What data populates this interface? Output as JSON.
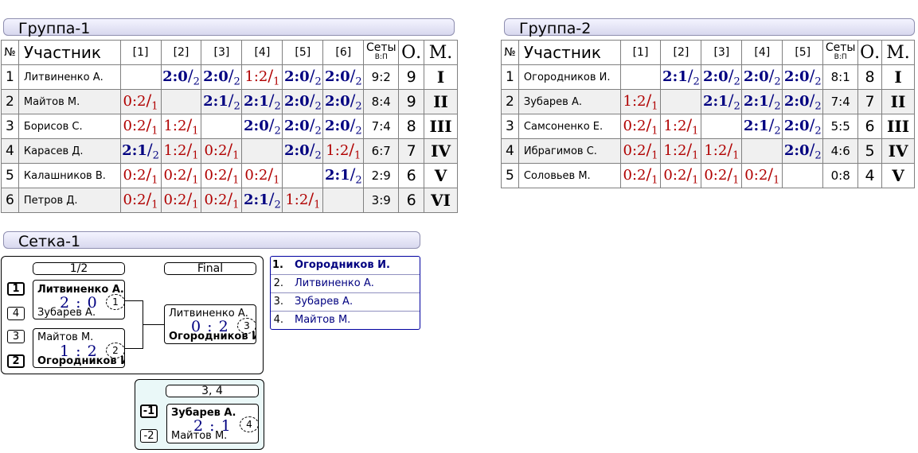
{
  "group1": {
    "title": "Группа-1",
    "headers": {
      "num": "№",
      "participant": "Участник",
      "cols": [
        "[1]",
        "[2]",
        "[3]",
        "[4]",
        "[5]",
        "[6]"
      ],
      "sets": "Сеты",
      "sets_sub": "В:П",
      "points": "О.",
      "place": "М."
    },
    "rows": [
      {
        "num": "1",
        "name": "Литвиненко А.",
        "results": [
          null,
          {
            "s": "2:0",
            "n": "2",
            "w": true
          },
          {
            "s": "2:0",
            "n": "2",
            "w": true
          },
          {
            "s": "1:2",
            "n": "1",
            "w": false
          },
          {
            "s": "2:0",
            "n": "2",
            "w": true
          },
          {
            "s": "2:0",
            "n": "2",
            "w": true
          }
        ],
        "sets": "9:2",
        "points": "9",
        "place": "I"
      },
      {
        "num": "2",
        "name": "Майтов М.",
        "results": [
          {
            "s": "0:2",
            "n": "1",
            "w": false
          },
          null,
          {
            "s": "2:1",
            "n": "2",
            "w": true
          },
          {
            "s": "2:1",
            "n": "2",
            "w": true
          },
          {
            "s": "2:0",
            "n": "2",
            "w": true
          },
          {
            "s": "2:0",
            "n": "2",
            "w": true
          }
        ],
        "sets": "8:4",
        "points": "9",
        "place": "II"
      },
      {
        "num": "3",
        "name": "Борисов С.",
        "results": [
          {
            "s": "0:2",
            "n": "1",
            "w": false
          },
          {
            "s": "1:2",
            "n": "1",
            "w": false
          },
          null,
          {
            "s": "2:0",
            "n": "2",
            "w": true
          },
          {
            "s": "2:0",
            "n": "2",
            "w": true
          },
          {
            "s": "2:0",
            "n": "2",
            "w": true
          }
        ],
        "sets": "7:4",
        "points": "8",
        "place": "III"
      },
      {
        "num": "4",
        "name": "Карасев Д.",
        "results": [
          {
            "s": "2:1",
            "n": "2",
            "w": true
          },
          {
            "s": "1:2",
            "n": "1",
            "w": false
          },
          {
            "s": "0:2",
            "n": "1",
            "w": false
          },
          null,
          {
            "s": "2:0",
            "n": "2",
            "w": true
          },
          {
            "s": "1:2",
            "n": "1",
            "w": false
          }
        ],
        "sets": "6:7",
        "points": "7",
        "place": "IV"
      },
      {
        "num": "5",
        "name": "Калашников В.",
        "results": [
          {
            "s": "0:2",
            "n": "1",
            "w": false
          },
          {
            "s": "0:2",
            "n": "1",
            "w": false
          },
          {
            "s": "0:2",
            "n": "1",
            "w": false
          },
          {
            "s": "0:2",
            "n": "1",
            "w": false
          },
          null,
          {
            "s": "2:1",
            "n": "2",
            "w": true
          }
        ],
        "sets": "2:9",
        "points": "6",
        "place": "V"
      },
      {
        "num": "6",
        "name": "Петров Д.",
        "results": [
          {
            "s": "0:2",
            "n": "1",
            "w": false
          },
          {
            "s": "0:2",
            "n": "1",
            "w": false
          },
          {
            "s": "0:2",
            "n": "1",
            "w": false
          },
          {
            "s": "2:1",
            "n": "2",
            "w": true
          },
          {
            "s": "1:2",
            "n": "1",
            "w": false
          },
          null
        ],
        "sets": "3:9",
        "points": "6",
        "place": "VI"
      }
    ]
  },
  "group2": {
    "title": "Группа-2",
    "headers": {
      "num": "№",
      "participant": "Участник",
      "cols": [
        "[1]",
        "[2]",
        "[3]",
        "[4]",
        "[5]"
      ],
      "sets": "Сеты",
      "sets_sub": "В:П",
      "points": "О.",
      "place": "М."
    },
    "rows": [
      {
        "num": "1",
        "name": "Огородников И.",
        "results": [
          null,
          {
            "s": "2:1",
            "n": "2",
            "w": true
          },
          {
            "s": "2:0",
            "n": "2",
            "w": true
          },
          {
            "s": "2:0",
            "n": "2",
            "w": true
          },
          {
            "s": "2:0",
            "n": "2",
            "w": true
          }
        ],
        "sets": "8:1",
        "points": "8",
        "place": "I"
      },
      {
        "num": "2",
        "name": "Зубарев А.",
        "results": [
          {
            "s": "1:2",
            "n": "1",
            "w": false
          },
          null,
          {
            "s": "2:1",
            "n": "2",
            "w": true
          },
          {
            "s": "2:1",
            "n": "2",
            "w": true
          },
          {
            "s": "2:0",
            "n": "2",
            "w": true
          }
        ],
        "sets": "7:4",
        "points": "7",
        "place": "II"
      },
      {
        "num": "3",
        "name": "Самсоненко Е.",
        "results": [
          {
            "s": "0:2",
            "n": "1",
            "w": false
          },
          {
            "s": "1:2",
            "n": "1",
            "w": false
          },
          null,
          {
            "s": "2:1",
            "n": "2",
            "w": true
          },
          {
            "s": "2:0",
            "n": "2",
            "w": true
          }
        ],
        "sets": "5:5",
        "points": "6",
        "place": "III"
      },
      {
        "num": "4",
        "name": "Ибрагимов С.",
        "results": [
          {
            "s": "0:2",
            "n": "1",
            "w": false
          },
          {
            "s": "1:2",
            "n": "1",
            "w": false
          },
          {
            "s": "1:2",
            "n": "1",
            "w": false
          },
          null,
          {
            "s": "2:0",
            "n": "2",
            "w": true
          }
        ],
        "sets": "4:6",
        "points": "5",
        "place": "IV"
      },
      {
        "num": "5",
        "name": "Соловьев М.",
        "results": [
          {
            "s": "0:2",
            "n": "1",
            "w": false
          },
          {
            "s": "0:2",
            "n": "1",
            "w": false
          },
          {
            "s": "0:2",
            "n": "1",
            "w": false
          },
          {
            "s": "0:2",
            "n": "1",
            "w": false
          },
          null
        ],
        "sets": "0:8",
        "points": "4",
        "place": "V"
      }
    ]
  },
  "bracket": {
    "title": "Сетка-1",
    "semi_label": "1/2",
    "final_label": "Final",
    "third_label": "3, 4",
    "semi1": {
      "seed_top": "1",
      "seed_bottom": "4",
      "top": "Литвиненко А.",
      "bottom": "Зубарев А.",
      "score": "2 : 0",
      "num": "1"
    },
    "semi2": {
      "seed_top": "3",
      "seed_bottom": "2",
      "top": "Майтов М.",
      "bottom": "Огородников И.",
      "score": "1 : 2",
      "num": "2"
    },
    "final": {
      "top": "Литвиненко А.",
      "bottom": "Огородников И.",
      "score": "0 : 2",
      "num": "3"
    },
    "third": {
      "seed_top": "-1",
      "seed_bottom": "-2",
      "top": "Зубарев А.",
      "bottom": "Майтов М.",
      "score": "2 : 1",
      "num": "4"
    },
    "places": [
      {
        "pos": "1.",
        "name": "Огородников И."
      },
      {
        "pos": "2.",
        "name": "Литвиненко А."
      },
      {
        "pos": "3.",
        "name": "Зубарев А."
      },
      {
        "pos": "4.",
        "name": "Майтов М."
      }
    ]
  }
}
